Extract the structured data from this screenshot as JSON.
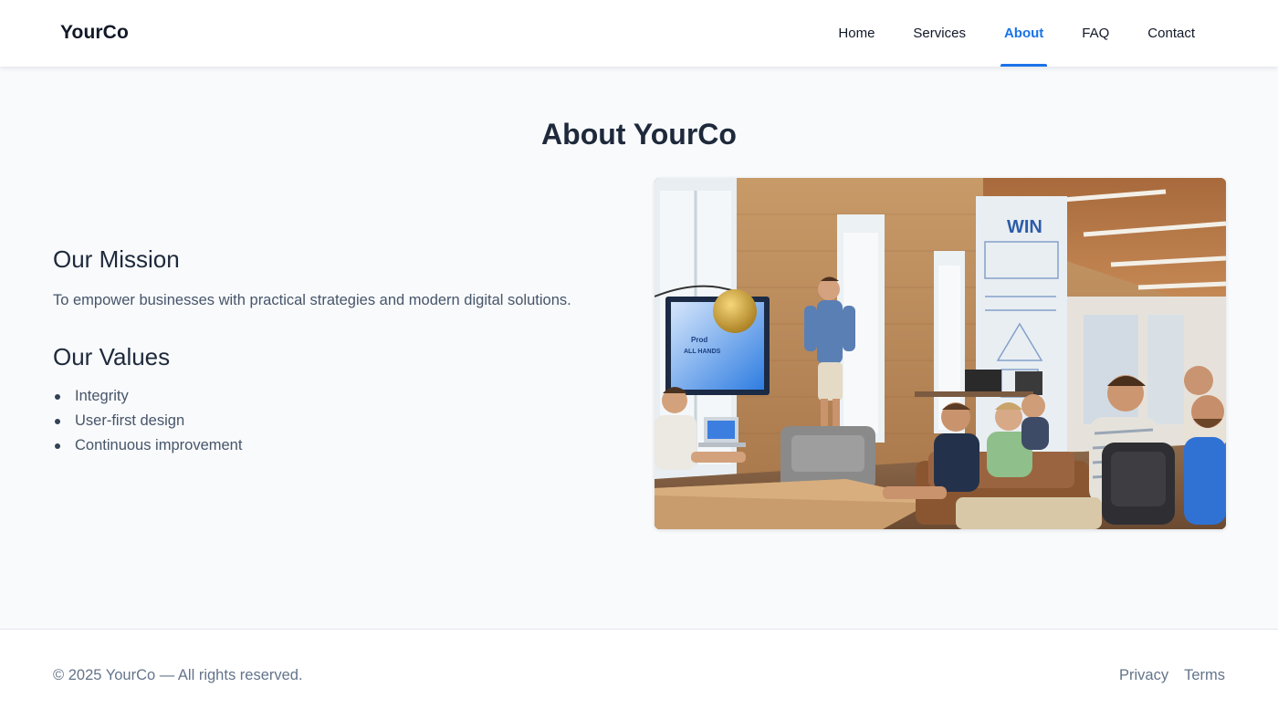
{
  "header": {
    "brand": "YourCo",
    "nav": [
      {
        "label": "Home",
        "active": false
      },
      {
        "label": "Services",
        "active": false
      },
      {
        "label": "About",
        "active": true
      },
      {
        "label": "FAQ",
        "active": false
      },
      {
        "label": "Contact",
        "active": false
      }
    ]
  },
  "main": {
    "title": "About YourCo",
    "mission": {
      "heading": "Our Mission",
      "text": "To empower businesses with practical strategies and modern digital solutions."
    },
    "values": {
      "heading": "Our Values",
      "items": [
        "Integrity",
        "User-first design",
        "Continuous improvement"
      ]
    },
    "photo": {
      "screen_text": [
        "Prod",
        "ALL HANDS"
      ],
      "wall_text": "WIN"
    }
  },
  "footer": {
    "copyright": "© 2025 YourCo — All rights reserved.",
    "links": [
      "Privacy",
      "Terms"
    ]
  },
  "colors": {
    "accent": "#1a73e8",
    "heading": "#1e293b",
    "body_text": "#475569",
    "page_bg": "#f8fafc",
    "footer_text": "#64748b"
  }
}
